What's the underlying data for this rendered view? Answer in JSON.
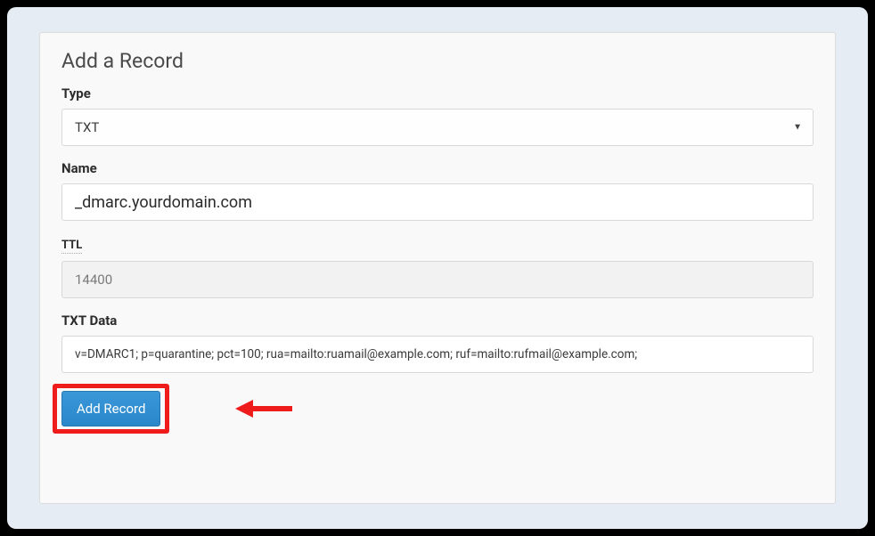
{
  "panel": {
    "title": "Add a Record"
  },
  "form": {
    "type": {
      "label": "Type",
      "value": "TXT"
    },
    "name": {
      "label": "Name",
      "value": "_dmarc.yourdomain.com"
    },
    "ttl": {
      "label": "TTL",
      "value": "14400"
    },
    "txt_data": {
      "label": "TXT Data",
      "value": "v=DMARC1; p=quarantine; pct=100; rua=mailto:ruamail@example.com; ruf=mailto:rufmail@example.com;"
    }
  },
  "actions": {
    "add_record_label": "Add Record"
  },
  "colors": {
    "highlight": "#ef1c1c",
    "button_bg": "#2f8fd2"
  }
}
